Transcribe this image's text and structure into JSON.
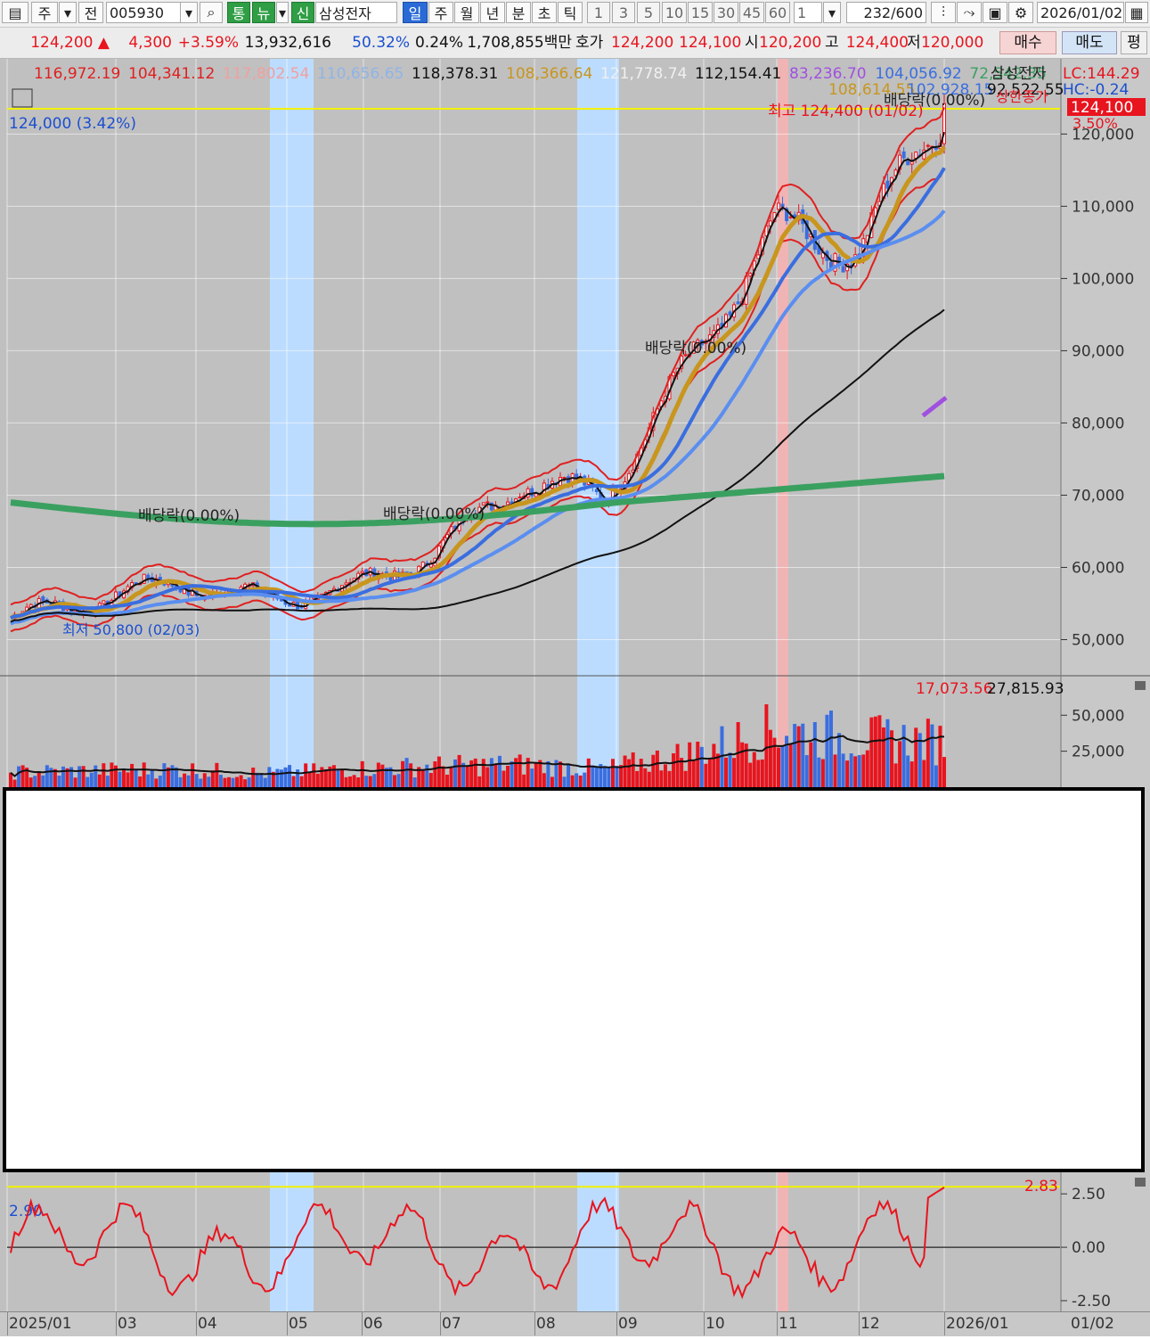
{
  "toolbar": {
    "mode1": "주",
    "mode2": "전",
    "code": "005930",
    "btn_tong": "통",
    "btn_nyu": "뉴",
    "btn_sin": "신",
    "stock_name": "삼성전자",
    "periods": [
      "일",
      "주",
      "월",
      "년",
      "분",
      "초",
      "틱"
    ],
    "intervals": [
      "1",
      "3",
      "5",
      "10",
      "15",
      "30",
      "45",
      "60"
    ],
    "interval_value": "1",
    "count": "232",
    "count_max": "/600",
    "date": "2026/01/02"
  },
  "quote": {
    "price": "124,200",
    "change": "4,300",
    "change_pct": "+3.59%",
    "volume": "13,932,616",
    "vol_ratio": "50.32%",
    "turnover": "0.24%",
    "amount": "1,708,855백만",
    "bid_label": "호가",
    "bid1": "124,200",
    "bid2": "124,100",
    "open_label": "시",
    "open": "120,200",
    "high_label": "고",
    "high": "124,400",
    "low_label": "저",
    "low": "120,000",
    "buy_label": "매수",
    "sell_label": "매도",
    "avg_label": "평"
  },
  "legend": {
    "ma_values": [
      {
        "text": "116,972.19",
        "color": "#e02020"
      },
      {
        "text": "104,341.12",
        "color": "#e02020"
      },
      {
        "text": "117,802.54",
        "color": "#f0a0a0"
      },
      {
        "text": "110,656.65",
        "color": "#8fb4e8"
      },
      {
        "text": "118,378.31",
        "color": "#111111"
      },
      {
        "text": "108,366.64",
        "color": "#c8961e"
      },
      {
        "text": "121,778.74",
        "color": "#f0f0f0"
      },
      {
        "text": "112,154.41",
        "color": "#111111"
      },
      {
        "text": "83,236.70",
        "color": "#a050e0"
      },
      {
        "text": "104,056.92",
        "color": "#3a6ee0"
      },
      {
        "text": "72,542.35",
        "color": "#3aa060"
      }
    ],
    "name": "삼성전자",
    "line2": [
      "108,614.55",
      "102,928.15",
      "92,522.55"
    ],
    "lc": "LC:144.29",
    "hc": "HC:-0.24",
    "dividend_top": "배당락(0.00%)",
    "upper_limit_tag": "상한종가",
    "last_price_tag": "124,100",
    "last_pct_tag": "3.50%",
    "high_note": "최고 124,400 (01/02)",
    "current_note": "124,000 (3.42%)",
    "low_note": "최저 50,800 (02/03)",
    "div_labels": [
      "배당락(0.00%)",
      "배당락(0.00%)",
      "배당락(0.00%)"
    ]
  },
  "y_axis_price": [
    "120,000",
    "110,000",
    "100,000",
    "90,000",
    "80,000",
    "70,000",
    "60,000",
    "50,000"
  ],
  "volume_legend": [
    "17,073.56",
    "27,815.93"
  ],
  "y_axis_volume": [
    "50,000",
    "25,000"
  ],
  "osc_value": "2.90",
  "osc_last": "2.83",
  "y_axis_osc": [
    "2.50",
    "0.00",
    "-2.50"
  ],
  "x_axis": [
    "2025/01",
    "03",
    "04",
    "05",
    "06",
    "07",
    "08",
    "09",
    "10",
    "11",
    "12",
    "2026/01",
    "01/02"
  ],
  "colors": {
    "up": "#e8141e",
    "down": "#3a6ee0",
    "highlight_band": "#bcdcff",
    "chart_bg": "#c0c0c0",
    "ref_line": "#f2f200"
  },
  "chart_data": [
    {
      "type": "line",
      "title": "삼성전자",
      "x": [
        "2025/01",
        "03",
        "04",
        "05",
        "06",
        "07",
        "08",
        "09",
        "10",
        "11",
        "12",
        "2026/01"
      ],
      "series": [
        {
          "name": "",
          "values": [
            53000,
            55500,
            58000,
            55500,
            57000,
            62000,
            72000,
            70000,
            88000,
            107000,
            104000,
            124000
          ]
        }
      ],
      "ylim": [
        45000,
        125000
      ],
      "grid": true
    },
    {
      "type": "bar",
      "x": [
        "2025/01",
        "03",
        "04",
        "05",
        "06",
        "07",
        "08",
        "09",
        "10",
        "11",
        "12",
        "2026/01"
      ],
      "series": [
        {
          "name": "",
          "values": [
            10000,
            11000,
            12000,
            9000,
            12000,
            14000,
            15000,
            12000,
            22000,
            38000,
            32000,
            30000
          ]
        }
      ],
      "ylim": [
        0,
        70000
      ]
    },
    {
      "type": "line",
      "x": [
        "2025/01",
        "03",
        "04",
        "05",
        "06",
        "07",
        "08",
        "09",
        "10",
        "11",
        "12",
        "2026/01"
      ],
      "series": [
        {
          "name": "",
          "values": [
            0.2,
            1.5,
            1.8,
            -0.5,
            0.8,
            1.0,
            2.0,
            -0.8,
            2.2,
            2.8,
            1.9,
            2.83
          ]
        }
      ],
      "ylim": [
        -3.0,
        3.3
      ]
    }
  ]
}
